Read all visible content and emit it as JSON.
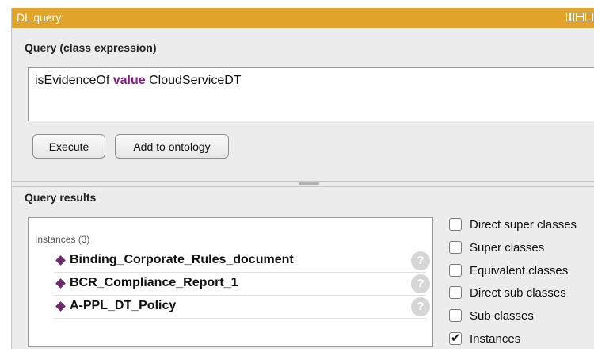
{
  "panel": {
    "title": "DL query:"
  },
  "query": {
    "section_label": "Query (class expression)",
    "expression_parts": [
      "isEvidenceOf",
      "value",
      "CloudServiceDT"
    ]
  },
  "buttons": {
    "execute": "Execute",
    "add_to_ontology": "Add to ontology"
  },
  "results": {
    "section_label": "Query results",
    "header": "Instances (3)",
    "items": [
      {
        "label": "Binding_Corporate_Rules_document"
      },
      {
        "label": "BCR_Compliance_Report_1"
      },
      {
        "label": "A-PPL_DT_Policy"
      }
    ],
    "help_glyph": "?"
  },
  "options": [
    {
      "label": "Direct super classes",
      "checked": false
    },
    {
      "label": "Super classes",
      "checked": false
    },
    {
      "label": "Equivalent classes",
      "checked": false
    },
    {
      "label": "Direct sub classes",
      "checked": false
    },
    {
      "label": "Sub classes",
      "checked": false
    },
    {
      "label": "Instances",
      "checked": true
    }
  ],
  "colors": {
    "titlebar": "#e2a32b",
    "keyword": "#8b1a8b",
    "instance_diamond": "#6b2a6b"
  }
}
